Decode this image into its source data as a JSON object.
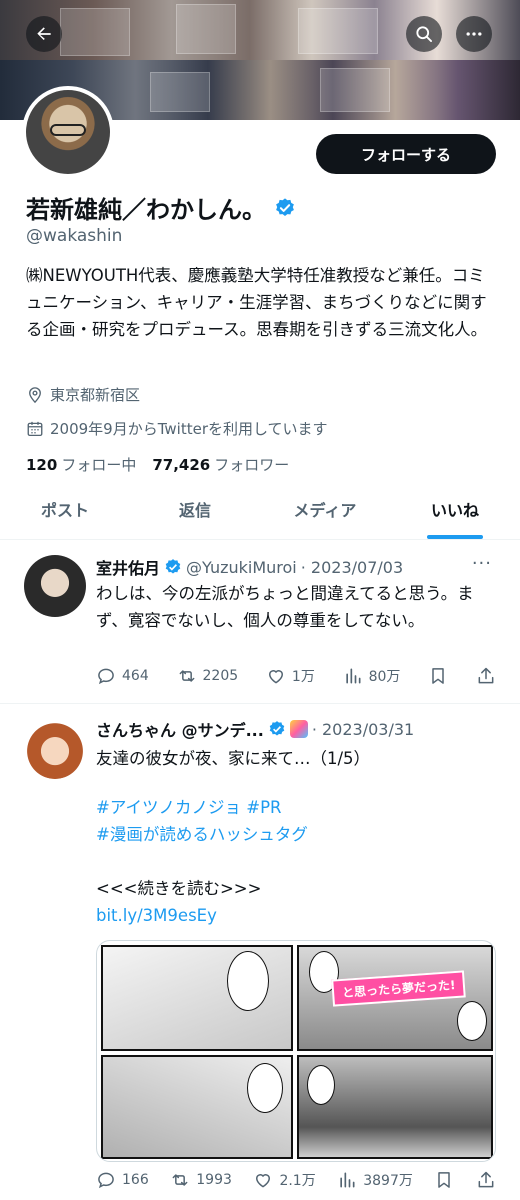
{
  "header": {
    "back_icon": "back-arrow-icon",
    "search_icon": "search-icon",
    "more_icon": "more-horizontal-icon"
  },
  "profile": {
    "follow_label": "フォローする",
    "name": "若新雄純／わかしん。",
    "handle": "@wakashin",
    "bio": "㈱NEWYOUTH代表、慶應義塾大学特任准教授など兼任。コミュニケーション、キャリア・生涯学習、まちづくりなどに関する企画・研究をプロデュース。思春期を引きずる三流文化人。",
    "location": "東京都新宿区",
    "joined": "2009年9月からTwitterを利用しています",
    "following_count": "120",
    "following_label": "フォロー中",
    "followers_count": "77,426",
    "followers_label": "フォロワー"
  },
  "tabs": [
    {
      "label": "ポスト"
    },
    {
      "label": "返信"
    },
    {
      "label": "メディア"
    },
    {
      "label": "いいね"
    }
  ],
  "tweets": [
    {
      "name": "室井佑月",
      "handle": "@YuzukiMuroi",
      "date": "· 2023/07/03",
      "text": "わしは、今の左派がちょっと間違えてると思う。まず、寛容でないし、個人の尊重をしてない。",
      "replies": "464",
      "retweets": "2205",
      "likes": "1万",
      "views": "80万"
    },
    {
      "name": "さんちゃん @サンデ...",
      "date": "· 2023/03/31",
      "text": "友達の彼女が夜、家に来て…（1/5）",
      "hashtags_line1": "#アイツノカノジョ #PR",
      "hashtags_line2": "#漫画が読めるハッシュタグ",
      "read_more": "<<<続きを読む>>>",
      "url": "bit.ly/3M9esEy",
      "media_title": "と思ったら夢だった!",
      "replies": "166",
      "retweets": "1993",
      "likes": "2.1万",
      "views": "3897万"
    }
  ],
  "colors": {
    "accent": "#1d9bf0",
    "text": "#0f1419",
    "secondary": "#536471"
  }
}
